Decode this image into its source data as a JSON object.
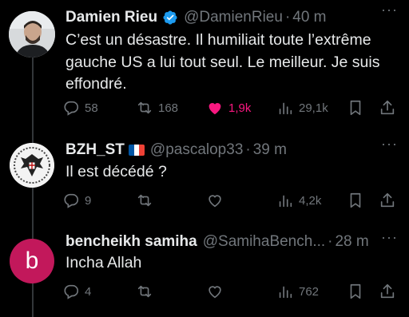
{
  "tweets": [
    {
      "author": "Damien Rieu",
      "handle": "@DamienRieu",
      "time": "40 m",
      "verified": true,
      "text_lines": [
        "C’est un désastre. Il humiliait toute l’extrême",
        "gauche US a lui tout seul. Le meilleur. Je suis",
        "effondré."
      ],
      "replies": "58",
      "retweets": "168",
      "likes": "1,9k",
      "liked": true,
      "views": "29,1k"
    },
    {
      "author": "BZH_ST",
      "flag": "FR",
      "handle": "@pascalop33",
      "time": "39 m",
      "text": "Il est décédé ?",
      "replies": "9",
      "views": "4,2k"
    },
    {
      "author": "bencheikh samiha",
      "handle": "@SamihaBench...",
      "time": "28 m",
      "avatar_letter": "b",
      "avatar_color": "#c2185b",
      "text": "Incha Allah",
      "replies": "4",
      "views": "762"
    }
  ],
  "separator": "·",
  "more_label": "···"
}
